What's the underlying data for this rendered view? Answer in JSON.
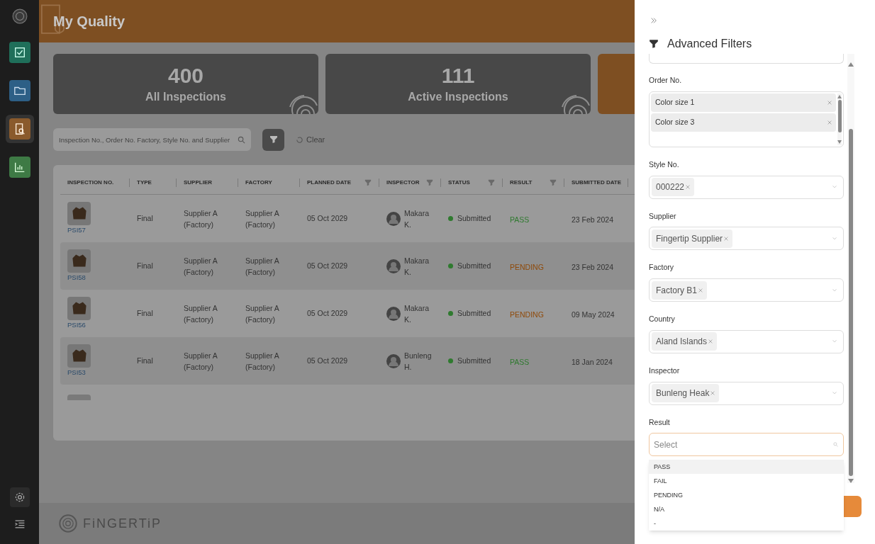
{
  "header": {
    "title": "My Quality"
  },
  "sidebar": {
    "items": [
      {
        "kind": "tasks",
        "selected": false
      },
      {
        "kind": "folder",
        "selected": false
      },
      {
        "kind": "quality",
        "selected": true
      },
      {
        "kind": "chart",
        "selected": false
      }
    ]
  },
  "stats": [
    {
      "value": "400",
      "label": "All Inspections"
    },
    {
      "value": "111",
      "label": "Active Inspections"
    }
  ],
  "search": {
    "placeholder": "Inspection No., Order No. Factory, Style No. and Supplier"
  },
  "clear_button": "Clear",
  "table": {
    "columns": [
      {
        "label": "INSPECTION NO.",
        "filter": false
      },
      {
        "label": "TYPE",
        "filter": false
      },
      {
        "label": "SUPPLIER",
        "filter": false
      },
      {
        "label": "FACTORY",
        "filter": false
      },
      {
        "label": "PLANNED DATE",
        "filter": true
      },
      {
        "label": "INSPECTOR",
        "filter": true
      },
      {
        "label": "STATUS",
        "filter": true
      },
      {
        "label": "RESULT",
        "filter": true
      },
      {
        "label": "SUBMITTED DATE"
      }
    ],
    "rows": [
      {
        "id": "PSI57",
        "type": "Final",
        "supplier": "Supplier A (Factory)",
        "factory": "Supplier A (Factory)",
        "planned": "05 Oct 2029",
        "inspector": "Makara K.",
        "status": "Submitted",
        "result": "PASS",
        "color": "#2f7a2f",
        "submitted": "23 Feb 2024"
      },
      {
        "id": "PSI58",
        "type": "Final",
        "supplier": "Supplier A (Factory)",
        "factory": "Supplier A (Factory)",
        "planned": "05 Oct 2029",
        "inspector": "Makara K.",
        "status": "Submitted",
        "result": "PENDING",
        "color": "#8f4a0a",
        "submitted": "23 Feb 2024"
      },
      {
        "id": "PSI56",
        "type": "Final",
        "supplier": "Supplier A (Factory)",
        "factory": "Supplier A (Factory)",
        "planned": "05 Oct 2029",
        "inspector": "Makara K.",
        "status": "Submitted",
        "result": "PENDING",
        "color": "#8f4a0a",
        "submitted": "09 May 2024"
      },
      {
        "id": "PSI53",
        "type": "Final",
        "supplier": "Supplier A (Factory)",
        "factory": "Supplier A (Factory)",
        "planned": "05 Oct 2029",
        "inspector": "Bunleng H.",
        "status": "Submitted",
        "result": "PASS",
        "color": "#2f7a2f",
        "submitted": "18 Jan 2024"
      }
    ]
  },
  "footer": {
    "logo_text": "FiNGERTiP"
  },
  "drawer": {
    "title": "Advanced Filters",
    "order_no": {
      "label": "Order No.",
      "tags": [
        "Color size 1",
        "Color size 3"
      ]
    },
    "filters": [
      {
        "label": "Style No.",
        "tag": "000222"
      },
      {
        "label": "Supplier",
        "tag": "Fingertip Supplier"
      },
      {
        "label": "Factory",
        "tag": "Factory B1"
      },
      {
        "label": "Country",
        "tag": "Aland Islands"
      },
      {
        "label": "Inspector",
        "tag": "Bunleng Heak"
      }
    ],
    "result": {
      "label": "Result",
      "placeholder": "Select",
      "options": [
        {
          "label": "PASS",
          "selected": true
        },
        {
          "label": "FAIL",
          "selected": false
        },
        {
          "label": "PENDING",
          "selected": false
        },
        {
          "label": "N/A",
          "selected": false
        },
        {
          "label": "-",
          "selected": false
        }
      ]
    }
  }
}
